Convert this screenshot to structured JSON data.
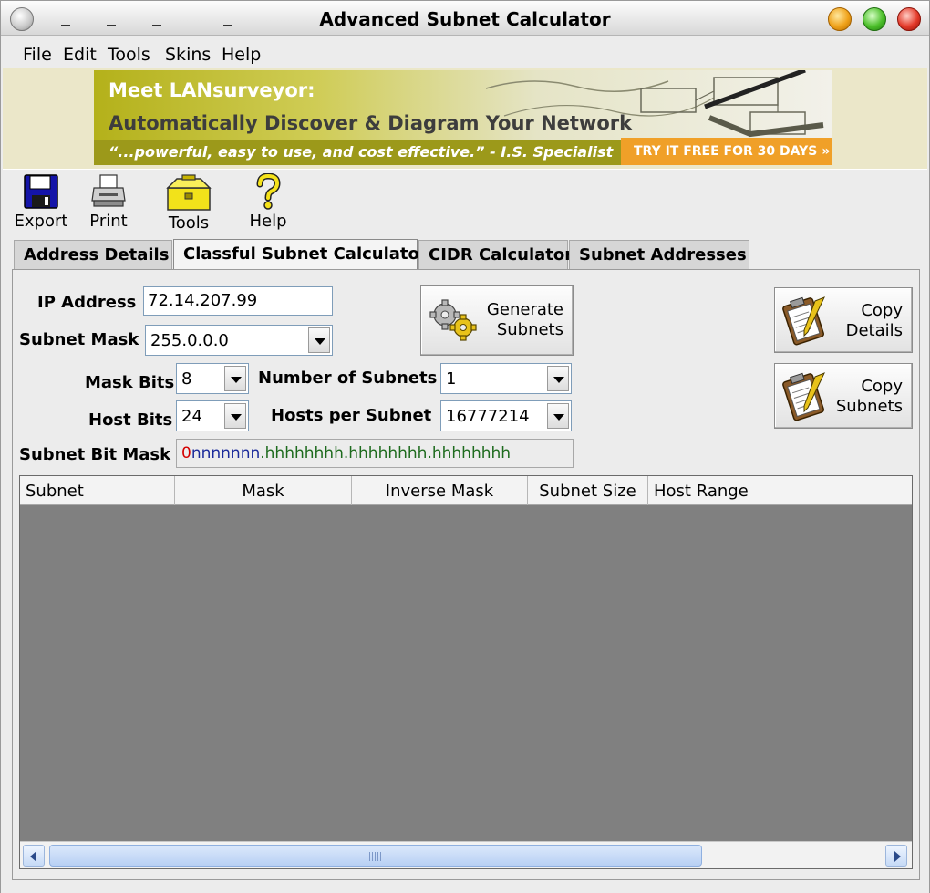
{
  "window": {
    "title": "Advanced Subnet Calculator"
  },
  "menu": [
    {
      "label": "File"
    },
    {
      "label": "Edit"
    },
    {
      "label": "Tools"
    },
    {
      "label": "Skins"
    },
    {
      "label": "Help"
    }
  ],
  "banner": {
    "headline": "Meet LANsurveyor:",
    "tagline": "Automatically Discover & Diagram Your Network",
    "quote": "“...powerful, easy to use, and cost effective.” - I.S. Specialist",
    "cta": "TRY IT FREE FOR 30 DAYS »"
  },
  "toolbar": {
    "export_label": "Export",
    "print_label": "Print",
    "tools_label": "Tools",
    "help_label": "Help"
  },
  "tabs": [
    {
      "label": "Address Details",
      "active": false
    },
    {
      "label": "Classful Subnet Calculator",
      "active": true
    },
    {
      "label": "CIDR Calculator",
      "active": false
    },
    {
      "label": "Subnet Addresses",
      "active": false
    }
  ],
  "form": {
    "ip_address_label": "IP Address",
    "ip_address_value": "72.14.207.99",
    "subnet_mask_label": "Subnet Mask",
    "subnet_mask_value": "255.0.0.0",
    "mask_bits_label": "Mask Bits",
    "mask_bits_value": "8",
    "host_bits_label": "Host Bits",
    "host_bits_value": "24",
    "num_subnets_label": "Number of Subnets",
    "num_subnets_value": "1",
    "hosts_per_subnet_label": "Hosts per Subnet",
    "hosts_per_subnet_value": "16777214",
    "bit_mask_label": "Subnet Bit Mask",
    "bit_mask_network": "0",
    "bit_mask_subnet": "nnnnnnn",
    "bit_mask_host": ".hhhhhhhh.hhhhhhhh.hhhhhhhh"
  },
  "buttons": {
    "generate_line1": "Generate",
    "generate_line2": "Subnets",
    "copy_details_line1": "Copy",
    "copy_details_line2": "Details",
    "copy_subnets_line1": "Copy",
    "copy_subnets_line2": "Subnets"
  },
  "table": {
    "columns": [
      "Subnet",
      "Mask",
      "Inverse Mask",
      "Subnet Size",
      "Host Range"
    ],
    "rows": []
  },
  "colors": {
    "bit_network": "#d40000",
    "bit_subnet": "#1a2a9a",
    "bit_host": "#1e6b1e",
    "list_background": "#808080"
  }
}
